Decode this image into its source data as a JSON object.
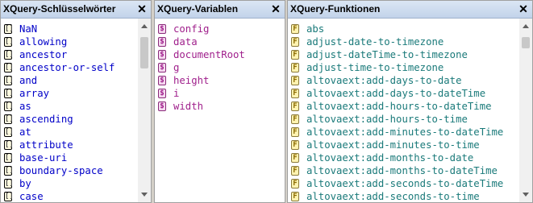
{
  "panes": [
    {
      "title": "XQuery-Schlüsselwörter",
      "close": "✕",
      "icon_glyph": "[]",
      "item_color": "#0000c8",
      "items": [
        "NaN",
        "allowing",
        "ancestor",
        "ancestor-or-self",
        "and",
        "array",
        "as",
        "ascending",
        "at",
        "attribute",
        "base-uri",
        "boundary-space",
        "by",
        "case"
      ]
    },
    {
      "title": "XQuery-Variablen",
      "close": "✕",
      "icon_glyph": "$",
      "item_color": "#a0208c",
      "items": [
        "config",
        "data",
        "documentRoot",
        "g",
        "height",
        "i",
        "width"
      ]
    },
    {
      "title": "XQuery-Funktionen",
      "close": "✕",
      "icon_glyph": "F",
      "item_color": "#1a7a7a",
      "items": [
        "abs",
        "adjust-date-to-timezone",
        "adjust-dateTime-to-timezone",
        "adjust-time-to-timezone",
        "altovaext:add-days-to-date",
        "altovaext:add-days-to-dateTime",
        "altovaext:add-hours-to-dateTime",
        "altovaext:add-hours-to-time",
        "altovaext:add-minutes-to-dateTime",
        "altovaext:add-minutes-to-time",
        "altovaext:add-months-to-date",
        "altovaext:add-months-to-dateTime",
        "altovaext:add-seconds-to-dateTime",
        "altovaext:add-seconds-to-time"
      ]
    }
  ]
}
